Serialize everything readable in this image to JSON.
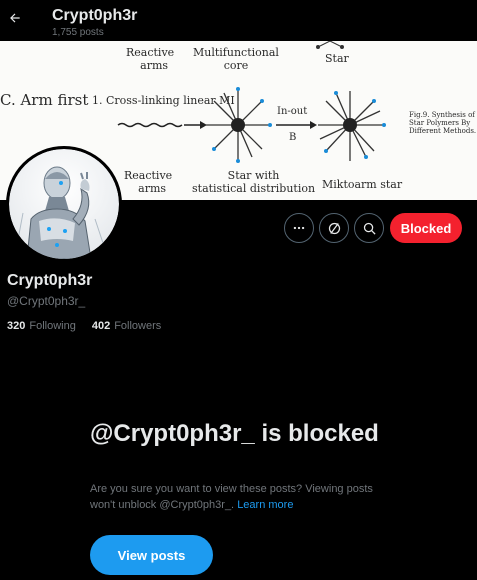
{
  "header": {
    "title": "Crypt0ph3r",
    "posts_count": "1,755 posts"
  },
  "banner": {
    "top_label_1": "Reactive",
    "top_label_1b": "arms",
    "top_label_2": "Multifunctional",
    "top_label_2b": "core",
    "top_label_3": "Star",
    "arm_first": "C. Arm first",
    "cross_linking": "1. Cross-linking linear MI",
    "in_out": "In-out",
    "b_label": "B",
    "fig_caption_1": "Fig.9. Synthesis of",
    "fig_caption_2": "Star Polymers By",
    "fig_caption_3": "Different Methods.",
    "bottom_label_1": "Reactive",
    "bottom_label_1b": "arms",
    "bottom_label_2": "Star with",
    "bottom_label_2b": "statistical distribution",
    "bottom_label_3": "Miktoarm star"
  },
  "profile": {
    "display_name": "Crypt0ph3r",
    "handle": "@Crypt0ph3r_",
    "following_count": "320",
    "following_label": "Following",
    "followers_count": "402",
    "followers_label": "Followers"
  },
  "actions": {
    "blocked_label": "Blocked"
  },
  "blocked_notice": {
    "title": "@Crypt0ph3r_ is blocked",
    "body": "Are you sure you want to view these posts? Viewing posts won't unblock @Crypt0ph3r_.",
    "learn_more": "Learn more",
    "view_posts": "View posts"
  },
  "colors": {
    "background": "#000000",
    "accent": "#1d9bf0",
    "danger": "#f4212e",
    "muted": "#71767b"
  },
  "icons": [
    "back-arrow-icon",
    "more-icon",
    "grok-icon",
    "search-icon"
  ]
}
